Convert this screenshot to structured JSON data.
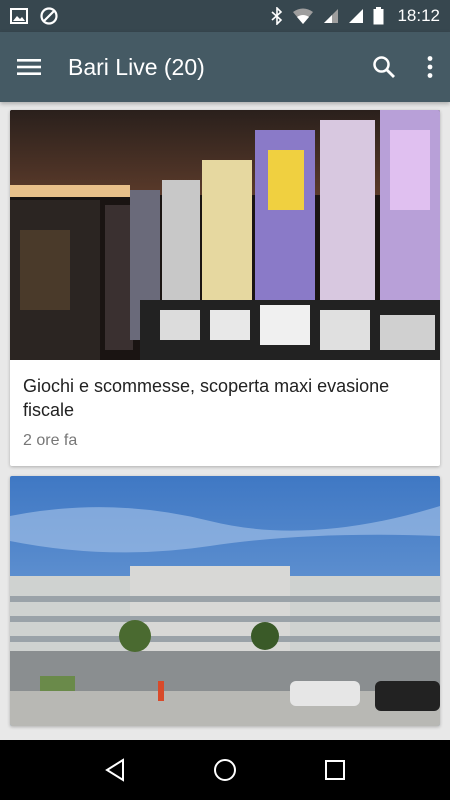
{
  "status_bar": {
    "time": "18:12",
    "left_icons": [
      "image-icon",
      "blocked-icon"
    ],
    "right_icons": [
      "bluetooth-icon",
      "wifi-icon",
      "signal-icon",
      "signal-icon",
      "battery-icon"
    ]
  },
  "app_bar": {
    "title": "Bari Live (20)",
    "menu_icon": "hamburger-menu-icon",
    "search_icon": "search-icon",
    "more_icon": "overflow-menu-icon"
  },
  "articles": [
    {
      "title": "Giochi e scommesse, scoperta maxi evasione fiscale",
      "meta": "2 ore fa",
      "image": "slot-machines-photo"
    },
    {
      "title": "",
      "meta": "",
      "image": "office-building-photo"
    }
  ],
  "nav_bar": {
    "icons": [
      "back-icon",
      "home-icon",
      "recents-icon"
    ]
  },
  "colors": {
    "status_bar": "#37474f",
    "app_bar": "#455a64",
    "background": "#e8e8e8"
  }
}
